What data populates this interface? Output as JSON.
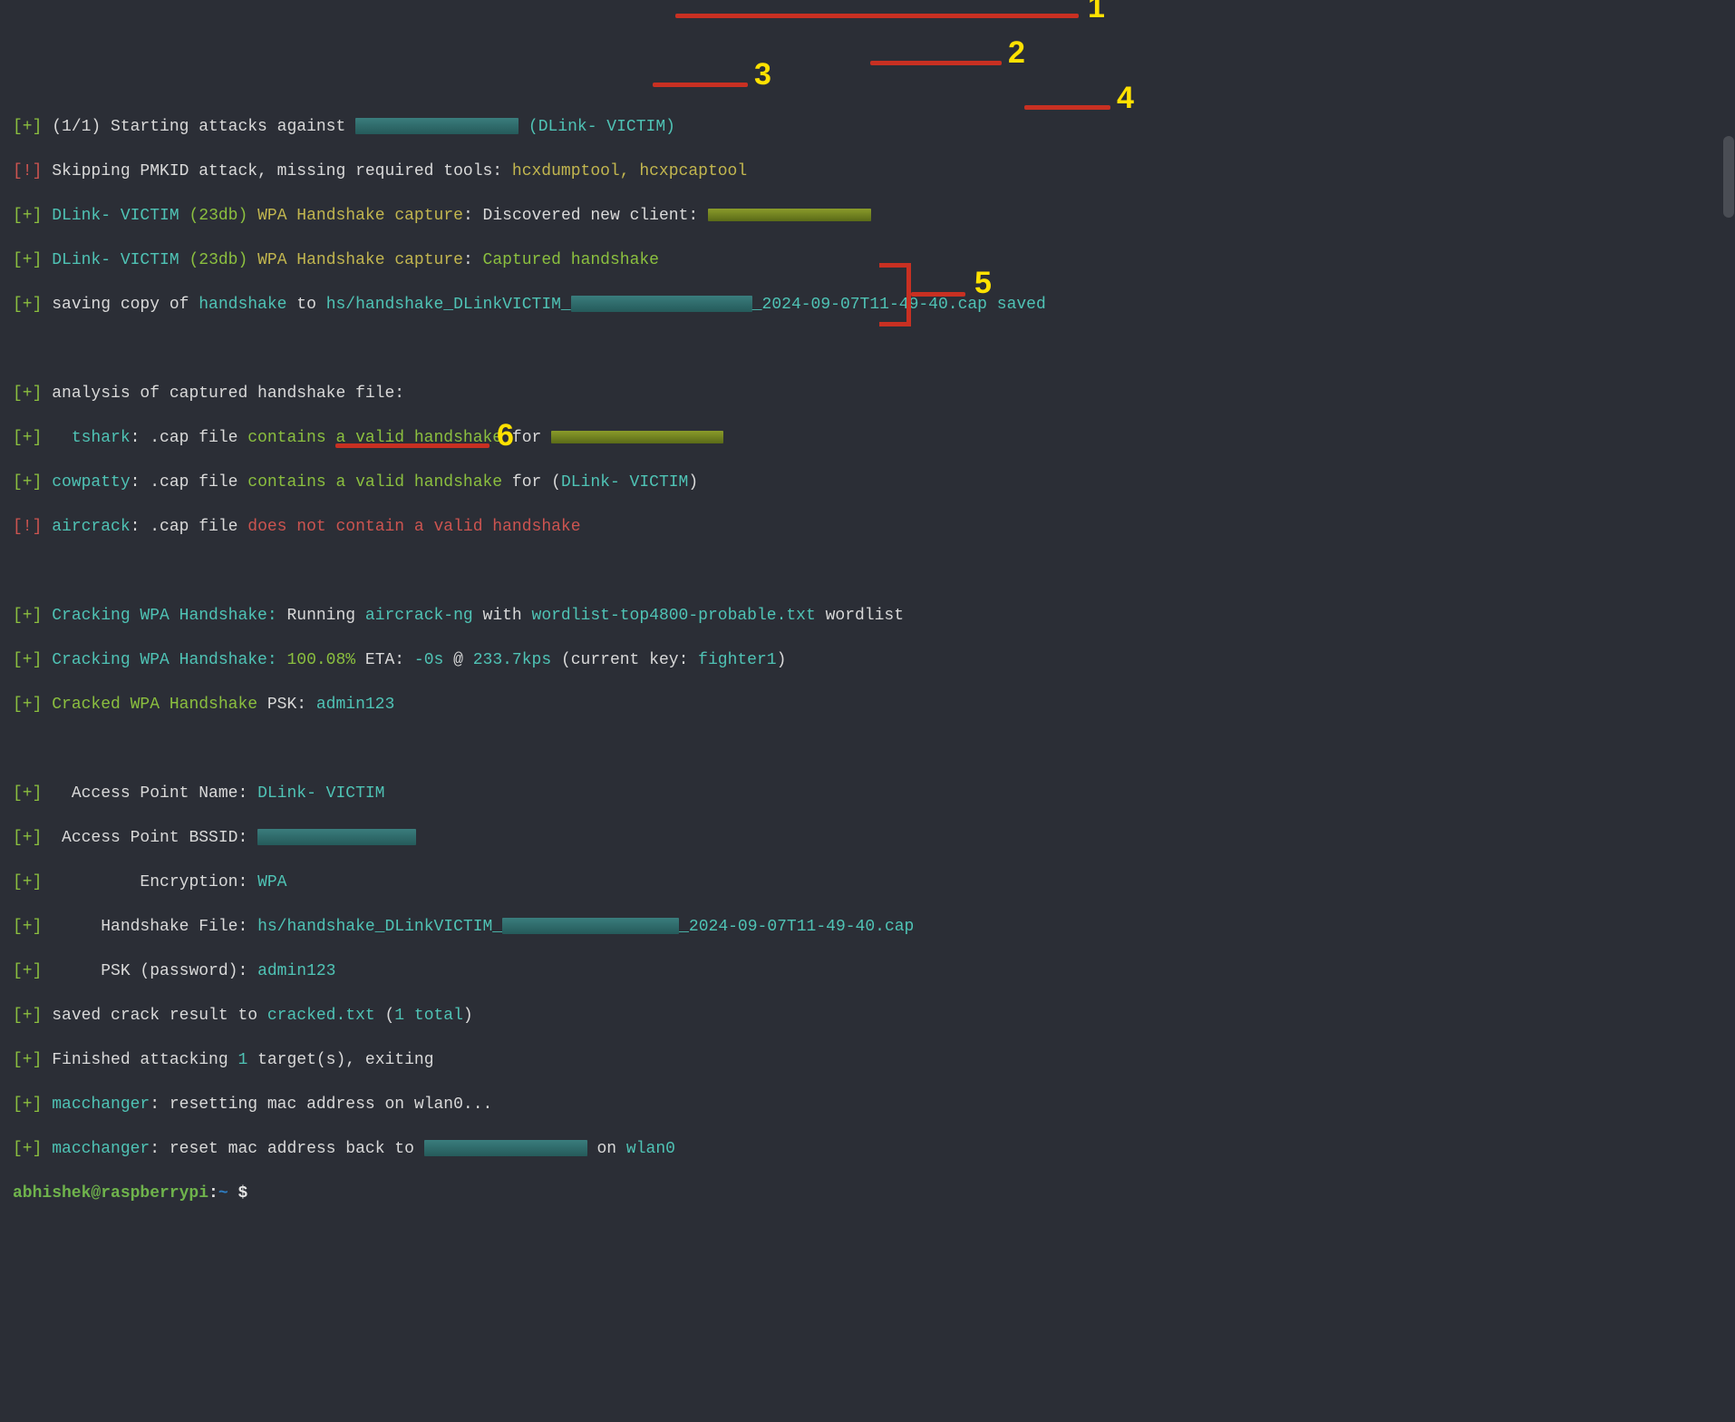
{
  "tag_plus": "[+]",
  "tag_warn": "[!]",
  "lines": {
    "l1_a": "(1/1) Starting attacks against ",
    "l1_b": "(DLink- VICTIM)",
    "l2_a": "Skipping PMKID attack, missing required tools: ",
    "l2_b": "hcxdumptool, hcxpcaptool",
    "l3_a": "DLink- VICTIM",
    "l3_b": "(23db)",
    "l3_c": "WPA Handshake capture",
    "l3_d": ": Discovered new client: ",
    "l4_d": ": ",
    "l4_e": "Captured handshake",
    "l5_a": "saving copy of ",
    "l5_b": "handshake",
    "l5_c": " to ",
    "l5_d": "hs/handshake_DLinkVICTIM_",
    "l5_e": "_2024-09-07T11-49-40.cap saved",
    "l7": "analysis of captured handshake file:",
    "l8_a": "tshark",
    "l8_b": ": .cap file ",
    "l8_c": "contains a valid handshake",
    "l8_d": " for ",
    "l9_a": "cowpatty",
    "l9_e": " for (",
    "l9_f": "DLink- VICTIM",
    "l9_g": ")",
    "l10_a": "aircrack",
    "l10_c": "does not contain a valid handshake",
    "l12_a": "Cracking WPA Handshake:",
    "l12_b": " Running ",
    "l12_c": "aircrack-ng",
    "l12_d": " with ",
    "l12_e": "wordlist-top4800-probable.txt",
    "l12_f": " wordlist",
    "l13_b": " 100.08%",
    "l13_c": " ETA: ",
    "l13_d": "-0s",
    "l13_e": " @ ",
    "l13_f": "233.7kps",
    "l13_g": " (current key: ",
    "l13_h": "fighter1",
    "l13_i": ")",
    "l14_a": "Cracked WPA Handshake",
    "l14_b": " PSK: ",
    "l14_c": "admin123",
    "l16_a": "  Access Point Name: ",
    "l16_b": "DLink- VICTIM",
    "l17_a": " Access Point BSSID: ",
    "l18_a": "         Encryption: ",
    "l18_b": "WPA",
    "l19_a": "     Handshake File: ",
    "l19_b": "hs/handshake_DLinkVICTIM_",
    "l19_c": "_2024-09-07T11-49-40.cap",
    "l20_a": "     PSK (password): ",
    "l20_b": "admin123",
    "l21_a": "saved crack result to ",
    "l21_b": "cracked.txt",
    "l21_c": " (",
    "l21_d": "1 total",
    "l21_e": ")",
    "l22_a": "Finished attacking ",
    "l22_b": "1",
    "l22_c": " target(s), exiting",
    "l23_a": "macchanger",
    "l23_b": ": resetting mac address on wlan0...",
    "l24_b": ": reset mac address back to ",
    "l24_c": " on ",
    "l24_d": "wlan0"
  },
  "prompt": {
    "user": "abhishek@raspberrypi",
    "sep": ":",
    "path": "~ ",
    "dollar": "$ "
  },
  "annotations": {
    "n1": "1",
    "n2": "2",
    "n3": "3",
    "n4": "4",
    "n5": "5",
    "n6": "6"
  }
}
